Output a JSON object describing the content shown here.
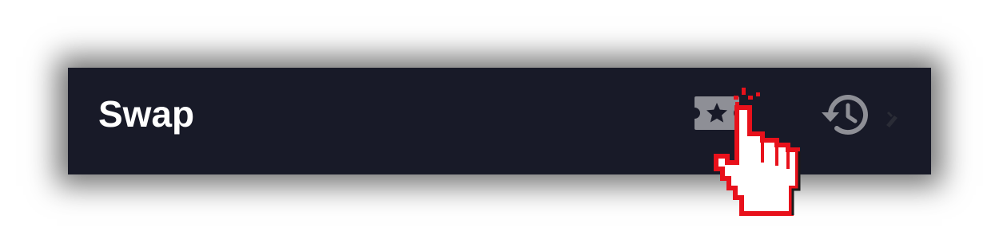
{
  "header": {
    "title": "Swap"
  },
  "icons": {
    "tickets": "star-ticket-icon",
    "history": "history-clock-icon",
    "partial": "pencil-icon",
    "cursor": "hand-pointer-cursor-icon"
  },
  "colors": {
    "header_background": "#181a28",
    "title_text": "#ffffff",
    "icon_gray": "#8e8f96",
    "cursor_outline": "#e8111b",
    "cursor_fill": "#ffffff"
  }
}
